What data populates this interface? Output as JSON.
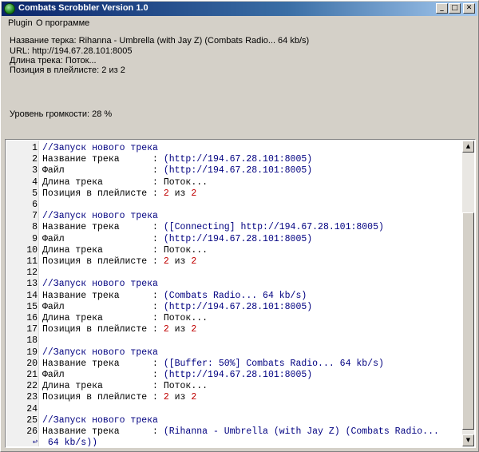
{
  "window": {
    "title": "Combats Scrobbler Version 1.0",
    "controls": {
      "minimize": "_",
      "maximize": "□",
      "close": "✕"
    }
  },
  "menu": [
    {
      "label": "Plugin"
    },
    {
      "label": "О программе"
    }
  ],
  "info": {
    "track_name": "Название терка: Rihanna - Umbrella (with Jay Z) (Combats Radio... 64 kb/s)",
    "url": "URL: http://194.67.28.101:8005",
    "length": "Длина трека: Поток...",
    "position": "Позиция в плейлисте: 2 из 2",
    "volume": "Уровень громкости: 28 %"
  },
  "log_lines": [
    {
      "n": "1",
      "parts": [
        {
          "t": "//Запуск нового трека",
          "c": "comment"
        }
      ]
    },
    {
      "n": "2",
      "parts": [
        {
          "t": "Название трека      : "
        },
        {
          "t": "(http://194.67.28.101:8005)",
          "c": "str"
        }
      ]
    },
    {
      "n": "3",
      "parts": [
        {
          "t": "Файл                : "
        },
        {
          "t": "(http://194.67.28.101:8005)",
          "c": "str"
        }
      ]
    },
    {
      "n": "4",
      "parts": [
        {
          "t": "Длина трека         : Поток..."
        }
      ]
    },
    {
      "n": "5",
      "parts": [
        {
          "t": "Позиция в плейлисте : "
        },
        {
          "t": "2",
          "c": "num"
        },
        {
          "t": " из "
        },
        {
          "t": "2",
          "c": "num"
        }
      ]
    },
    {
      "n": "6",
      "parts": []
    },
    {
      "n": "7",
      "parts": [
        {
          "t": "//Запуск нового трека",
          "c": "comment"
        }
      ]
    },
    {
      "n": "8",
      "parts": [
        {
          "t": "Название трека      : "
        },
        {
          "t": "([Connecting] http://194.67.28.101:8005)",
          "c": "str"
        }
      ]
    },
    {
      "n": "9",
      "parts": [
        {
          "t": "Файл                : "
        },
        {
          "t": "(http://194.67.28.101:8005)",
          "c": "str"
        }
      ]
    },
    {
      "n": "10",
      "parts": [
        {
          "t": "Длина трека         : Поток..."
        }
      ]
    },
    {
      "n": "11",
      "parts": [
        {
          "t": "Позиция в плейлисте : "
        },
        {
          "t": "2",
          "c": "num"
        },
        {
          "t": " из "
        },
        {
          "t": "2",
          "c": "num"
        }
      ]
    },
    {
      "n": "12",
      "parts": []
    },
    {
      "n": "13",
      "parts": [
        {
          "t": "//Запуск нового трека",
          "c": "comment"
        }
      ]
    },
    {
      "n": "14",
      "parts": [
        {
          "t": "Название трека      : "
        },
        {
          "t": "(Combats Radio... 64 kb/s)",
          "c": "str"
        }
      ]
    },
    {
      "n": "15",
      "parts": [
        {
          "t": "Файл                : "
        },
        {
          "t": "(http://194.67.28.101:8005)",
          "c": "str"
        }
      ]
    },
    {
      "n": "16",
      "parts": [
        {
          "t": "Длина трека         : Поток..."
        }
      ]
    },
    {
      "n": "17",
      "parts": [
        {
          "t": "Позиция в плейлисте : "
        },
        {
          "t": "2",
          "c": "num"
        },
        {
          "t": " из "
        },
        {
          "t": "2",
          "c": "num"
        }
      ]
    },
    {
      "n": "18",
      "parts": []
    },
    {
      "n": "19",
      "parts": [
        {
          "t": "//Запуск нового трека",
          "c": "comment"
        }
      ]
    },
    {
      "n": "20",
      "parts": [
        {
          "t": "Название трека      : "
        },
        {
          "t": "([Buffer: 50%] Combats Radio... 64 kb/s)",
          "c": "str"
        }
      ]
    },
    {
      "n": "21",
      "parts": [
        {
          "t": "Файл                : "
        },
        {
          "t": "(http://194.67.28.101:8005)",
          "c": "str"
        }
      ]
    },
    {
      "n": "22",
      "parts": [
        {
          "t": "Длина трека         : Поток..."
        }
      ]
    },
    {
      "n": "23",
      "parts": [
        {
          "t": "Позиция в плейлисте : "
        },
        {
          "t": "2",
          "c": "num"
        },
        {
          "t": " из "
        },
        {
          "t": "2",
          "c": "num"
        }
      ]
    },
    {
      "n": "24",
      "parts": []
    },
    {
      "n": "25",
      "parts": [
        {
          "t": "//Запуск нового трека",
          "c": "comment"
        }
      ]
    },
    {
      "n": "26",
      "parts": [
        {
          "t": "Название трека      : "
        },
        {
          "t": "(Rihanna - Umbrella (with Jay Z) (Combats Radio...",
          "c": "str"
        }
      ]
    },
    {
      "n": "↩",
      "wrap": true,
      "parts": [
        {
          "t": " 64 kb/s))",
          "c": "str"
        }
      ]
    }
  ],
  "scroll_position": 0.93,
  "scroll_visible_fraction": 0.77
}
